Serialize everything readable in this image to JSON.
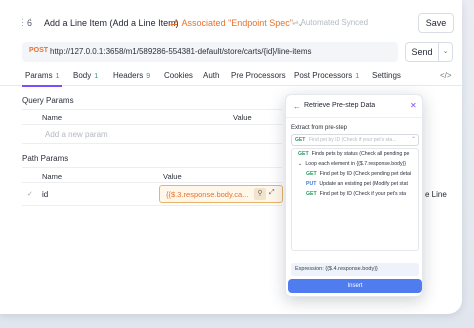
{
  "header": {
    "step_number": "6",
    "title": "Add a Line Item (Add a Line Item)",
    "associated": "Associated \"Endpoint Spec\"",
    "auto_synced": "Automated Synced",
    "save_label": "Save"
  },
  "request": {
    "method": "POST",
    "url": "http://127.0.0.1:3658/m1/589286-554381-default/store/carts/{id}/line-items",
    "send_label": "Send"
  },
  "tabs": [
    {
      "label": "Params",
      "count": "1"
    },
    {
      "label": "Body",
      "count": "1"
    },
    {
      "label": "Headers",
      "count": "9"
    },
    {
      "label": "Cookies",
      "count": ""
    },
    {
      "label": "Auth",
      "count": ""
    },
    {
      "label": "Pre Processors",
      "count": ""
    },
    {
      "label": "Post Processors",
      "count": "1"
    },
    {
      "label": "Settings",
      "count": ""
    }
  ],
  "query_params": {
    "section_label": "Query Params",
    "col_name": "Name",
    "col_value": "Value",
    "placeholder": "Add a new param"
  },
  "path_params": {
    "section_label": "Path Params",
    "col_name": "Name",
    "col_value": "Value",
    "rows": [
      {
        "name": "id",
        "value": "{{$.3.response.body.ca..."
      }
    ],
    "trailing_text": "e Line"
  },
  "popup": {
    "title": "Retrieve Pre-step Data",
    "extract_label": "Extract from pre-step",
    "search_method": "GET",
    "search_placeholder": "Find pet by ID (Check if your pet's sta...",
    "items": [
      {
        "method": "GET",
        "text": "Finds pets by status (Check all pending pe"
      },
      {
        "method": "",
        "text": "Loop each element in {{$.7.response.body}}"
      },
      {
        "method": "GET",
        "text": "Find pet by ID (Check pending pet detai"
      },
      {
        "method": "PUT",
        "text": "Update an existing pet (Modify pet stat"
      },
      {
        "method": "GET",
        "text": "Find pet by ID (Check if your pet's sta"
      }
    ],
    "expression": "Expression: {{$.4.response.body}}",
    "insert_label": "Insert"
  },
  "colors": {
    "accent": "#7c4dff",
    "orange": "#e8722c",
    "get": "#2a9d62",
    "put": "#3d7bd9",
    "insert_button": "#4f7df0"
  }
}
